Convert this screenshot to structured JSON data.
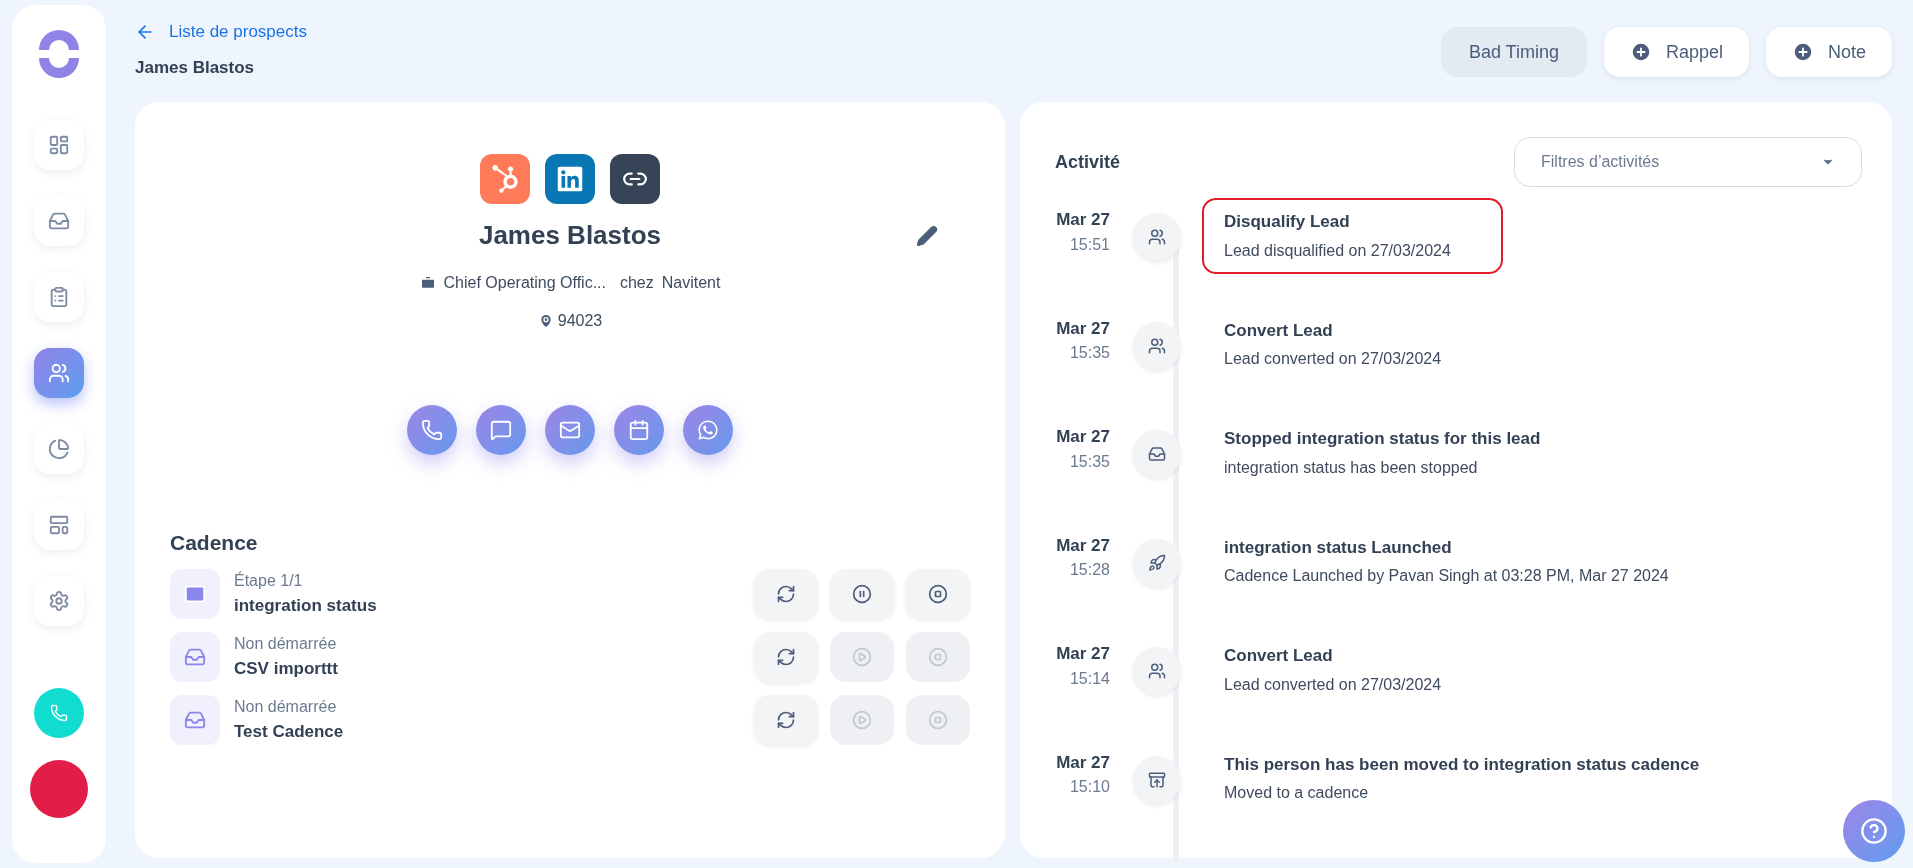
{
  "sidebar": {
    "items": [
      {
        "kind": "dashboard",
        "selected": false
      },
      {
        "kind": "cadences",
        "selected": false
      },
      {
        "kind": "tasks",
        "selected": false
      },
      {
        "kind": "people",
        "selected": true
      },
      {
        "kind": "stats",
        "selected": false
      },
      {
        "kind": "templates",
        "selected": false
      },
      {
        "kind": "settings",
        "selected": false
      }
    ]
  },
  "header": {
    "back_link": "Liste de prospects",
    "title": "James Blastos",
    "buttons": [
      {
        "kind": "plain",
        "label": "Bad Timing"
      },
      {
        "kind": "add",
        "label": "Rappel"
      },
      {
        "kind": "add",
        "label": "Note"
      }
    ]
  },
  "profile": {
    "integrations": [
      {
        "kind": "hubspot"
      },
      {
        "kind": "linkedin"
      },
      {
        "kind": "link"
      }
    ],
    "name": "James Blastos",
    "job_title": "Chief Operating Offic...",
    "company_prefix": "chez",
    "company": "Navitent",
    "location": "94023",
    "actions": [
      {
        "kind": "call"
      },
      {
        "kind": "sms"
      },
      {
        "kind": "email"
      },
      {
        "kind": "calendar"
      },
      {
        "kind": "whatsapp"
      }
    ]
  },
  "cadence": {
    "title": "Cadence",
    "items": [
      {
        "kind": "email",
        "status": "Étape 1/1",
        "name": "integration status",
        "controls": [
          {
            "kind": "refresh",
            "disabled": false
          },
          {
            "kind": "pause",
            "disabled": false
          },
          {
            "kind": "stop",
            "disabled": false
          }
        ]
      },
      {
        "kind": "cadence",
        "status": "Non démarrée",
        "name": "CSV importtt",
        "controls": [
          {
            "kind": "refresh",
            "disabled": false
          },
          {
            "kind": "play",
            "disabled": true
          },
          {
            "kind": "stop",
            "disabled": true
          }
        ]
      },
      {
        "kind": "cadence",
        "status": "Non démarrée",
        "name": "Test Cadence",
        "controls": [
          {
            "kind": "refresh",
            "disabled": false
          },
          {
            "kind": "play",
            "disabled": true
          },
          {
            "kind": "stop",
            "disabled": true
          }
        ]
      }
    ]
  },
  "activity": {
    "title": "Activité",
    "filter": {
      "placeholder": "Filtres d’activités"
    },
    "items": [
      {
        "kind": "people",
        "date": "Mar 27",
        "time": "15:51",
        "title": "Disqualify Lead",
        "detail": "Lead disqualified on 27/03/2024",
        "highlighted": true
      },
      {
        "kind": "people",
        "date": "Mar 27",
        "time": "15:35",
        "title": "Convert Lead",
        "detail": "Lead converted on 27/03/2024",
        "highlighted": false
      },
      {
        "kind": "cadence",
        "date": "Mar 27",
        "time": "15:35",
        "title": "Stopped integration status for this lead",
        "detail": "integration status has been stopped",
        "highlighted": false
      },
      {
        "kind": "rocket",
        "date": "Mar 27",
        "time": "15:28",
        "title": "integration status Launched",
        "detail": "Cadence Launched by Pavan Singh at 03:28 PM, Mar 27 2024",
        "highlighted": false
      },
      {
        "kind": "people",
        "date": "Mar 27",
        "time": "15:14",
        "title": "Convert Lead",
        "detail": "Lead converted on 27/03/2024",
        "highlighted": false
      },
      {
        "kind": "move",
        "date": "Mar 27",
        "time": "15:10",
        "title": "This person has been moved to integration status cadence",
        "detail": "Moved to a cadence",
        "highlighted": false
      }
    ]
  }
}
